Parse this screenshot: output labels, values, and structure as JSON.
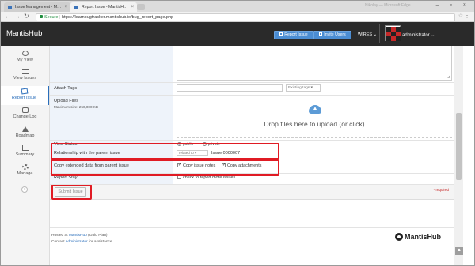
{
  "browser": {
    "tabs": [
      {
        "label": "Issue Management - M…",
        "active": false
      },
      {
        "label": "Report Issue - MantisH…",
        "active": true
      }
    ],
    "blurred_tab": "Nikolay — Microsoft Edge",
    "secure_label": "Secure",
    "url": "https://learnbugtracker.mantishub.io/bug_report_page.php"
  },
  "navbar": {
    "brand": "MantisHub",
    "report_issue_label": "Report Issue",
    "invite_users_label": "Invite Users",
    "project": "WIRES ⌄",
    "username": "administrator ⌄"
  },
  "sidebar": {
    "items": [
      {
        "label": "My View",
        "icon": "dashboard-icon"
      },
      {
        "label": "View Issues",
        "icon": "list-icon"
      },
      {
        "label": "Report Issue",
        "icon": "edit-icon",
        "active": true
      },
      {
        "label": "Change Log",
        "icon": "retweet-icon"
      },
      {
        "label": "Roadmap",
        "icon": "road-icon"
      },
      {
        "label": "Summary",
        "icon": "bar-chart-icon"
      },
      {
        "label": "Manage",
        "icon": "gears-icon"
      }
    ],
    "collapse_glyph": "«"
  },
  "form": {
    "attach_tags_label": "Attach Tags",
    "existing_tags_label": "Existing tags",
    "upload_files_label": "Upload Files",
    "max_size_label": "Maximum size: 250,000 KB",
    "drop_text": "Drop files here to upload (or click)",
    "view_status_label": "View Status",
    "view_status_public": "public",
    "view_status_private": "private",
    "relationship_label": "Relationship with the parent issue",
    "relationship_type": "related to",
    "parent_issue": "Issue 0000007",
    "copy_extended_label": "Copy extended data from parent issue",
    "copy_notes_label": "Copy issue notes",
    "copy_attachments_label": "Copy attachments",
    "report_stay_label": "Report Stay",
    "report_stay_option": "check to report more issues",
    "submit_label": "Submit Issue",
    "required_label": "* required"
  },
  "footer": {
    "hosted_prefix": "Hosted at",
    "hosted_link": "MantisHub",
    "hosted_suffix": "(Gold Plan)",
    "contact_prefix": "Contact",
    "contact_link": "administrator",
    "contact_suffix": "for assistance",
    "logo_text": "MantisHub"
  },
  "colors": {
    "accent": "#2a6ebb",
    "annotation": "#e01b24",
    "navbar": "#2a2a2a"
  }
}
